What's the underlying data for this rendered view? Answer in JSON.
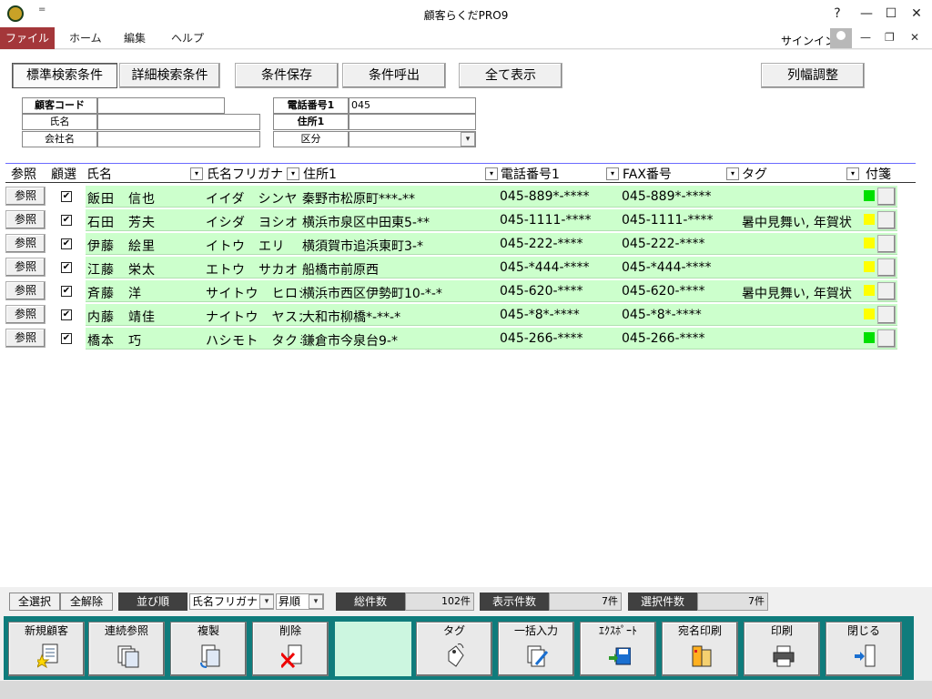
{
  "window": {
    "title": "顧客らくだPRO9",
    "qat": "=",
    "help": "?",
    "minimize": "—",
    "maximize": "☐",
    "close": "✕"
  },
  "ribbon": {
    "tabs": [
      "ファイル",
      "ホーム",
      "編集",
      "ヘルプ"
    ],
    "signin": "サインイン",
    "min": "—",
    "restore": "❐",
    "close": "✕"
  },
  "search_buttons": {
    "standard": "標準検索条件",
    "detail": "詳細検索条件",
    "save": "条件保存",
    "recall": "条件呼出",
    "show_all": "全て表示",
    "column_width": "列幅調整"
  },
  "criteria": {
    "customer_code_label": "顧客コード",
    "customer_code_value": "",
    "name_label": "氏名",
    "name_value": "",
    "company_label": "会社名",
    "company_value": "",
    "phone_label": "電話番号1",
    "phone_value": "045",
    "address_label": "住所1",
    "address_value": "",
    "category_label": "区分",
    "category_value": ""
  },
  "columns": {
    "ref": "参照",
    "sel": "顧選",
    "name": "氏名",
    "kana": "氏名フリガナ",
    "address": "住所1",
    "tel": "電話番号1",
    "fax": "FAX番号",
    "tag": "タグ",
    "sticky": "付箋"
  },
  "rows": [
    {
      "ref": "参照",
      "name": "飯田　信也",
      "kana": "イイダ　シンヤ",
      "address": "秦野市松原町***-**",
      "tel": "045-889*-****",
      "fax": "045-889*-****",
      "tag": "",
      "color": "#00e000"
    },
    {
      "ref": "参照",
      "name": "石田　芳夫",
      "kana": "イシダ　ヨシオ",
      "address": "横浜市泉区中田東5-**",
      "tel": "045-1111-****",
      "fax": "045-1111-****",
      "tag": "暑中見舞い, 年賀状",
      "color": "#ffff00"
    },
    {
      "ref": "参照",
      "name": "伊藤　絵里",
      "kana": "イトウ　エリ",
      "address": "横須賀市追浜東町3-*",
      "tel": "045-222-****",
      "fax": "045-222-****",
      "tag": "",
      "color": "#ffff00"
    },
    {
      "ref": "参照",
      "name": "江藤　栄太",
      "kana": "エトウ　サカオ",
      "address": "船橋市前原西",
      "tel": "045-*444-****",
      "fax": "045-*444-****",
      "tag": "",
      "color": "#ffff00"
    },
    {
      "ref": "参照",
      "name": "斉藤　洋",
      "kana": "サイトウ　ヒロシ",
      "address": "横浜市西区伊勢町10-*-*",
      "tel": "045-620-****",
      "fax": "045-620-****",
      "tag": "暑中見舞い, 年賀状",
      "color": "#ffff00"
    },
    {
      "ref": "参照",
      "name": "内藤　靖佳",
      "kana": "ナイトウ　ヤスカ",
      "address": "大和市柳橋*-**-*",
      "tel": "045-*8*-****",
      "fax": "045-*8*-****",
      "tag": "",
      "color": "#ffff00"
    },
    {
      "ref": "参照",
      "name": "橋本　巧",
      "kana": "ハシモト　タクミ",
      "address": "鎌倉市今泉台9-*",
      "tel": "045-266-****",
      "fax": "045-266-****",
      "tag": "",
      "color": "#00e000"
    }
  ],
  "status": {
    "select_all": "全選択",
    "deselect_all": "全解除",
    "sort_label": "並び順",
    "sort_field": "氏名フリガナ",
    "sort_order": "昇順",
    "total_label": "総件数",
    "total_value": "102件",
    "shown_label": "表示件数",
    "shown_value": "7件",
    "selected_label": "選択件数",
    "selected_value": "7件"
  },
  "toolbar": {
    "new_customer": "新規顧客",
    "continuous_ref": "連続参照",
    "duplicate": "複製",
    "delete": "削除",
    "tag": "タグ",
    "bulk_input": "一括入力",
    "export": "ｴｸｽﾎﾟｰﾄ",
    "address_print": "宛名印刷",
    "print": "印刷",
    "close": "閉じる"
  }
}
